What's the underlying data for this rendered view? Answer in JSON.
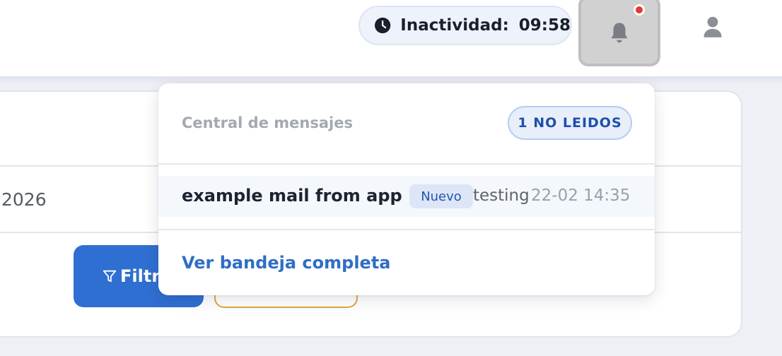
{
  "header": {
    "inactivity": {
      "label": "Inactividad:",
      "value": "09:58",
      "icon": "clock-icon"
    },
    "notifications": {
      "icon": "bell-icon",
      "has_unread": true,
      "dot_color": "#e53935"
    },
    "user": {
      "icon": "user-icon"
    }
  },
  "filters": {
    "date_value": "2026",
    "filter_button_label": "Filtr",
    "filter_icon": "filter-icon"
  },
  "message_center": {
    "title": "Central de mensajes",
    "unread_badge": "1 NO LEIDOS",
    "messages": [
      {
        "subject": "example mail from app",
        "badge": "Nuevo",
        "preview": "testing",
        "time": "22-02 14:35"
      }
    ],
    "view_all_label": "Ver bandeja completa"
  },
  "colors": {
    "accent": "#2f6fd1",
    "link": "#2f6fc4",
    "badge_text": "#1f4fa8",
    "warning_outline": "#e0a73a"
  }
}
